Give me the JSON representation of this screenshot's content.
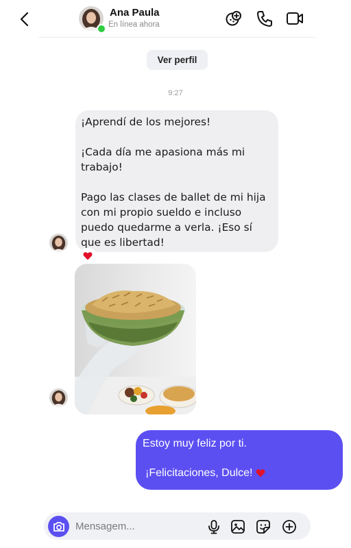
{
  "header": {
    "contact_name": "Ana Paula",
    "status": "En línea ahora",
    "icons": [
      "back-arrow-icon",
      "video-game-icon",
      "phone-icon",
      "video-camera-icon"
    ]
  },
  "profile_button": {
    "label": "Ver perfil"
  },
  "timestamp": "9:27",
  "incoming_message": {
    "paragraphs": [
      "¡Aprendí de los mejores!",
      "¡Cada día me apasiona más mi trabajo!",
      "Pago las clases de ballet de mi hija con mi propio sueldo e incluso puedo quedarme a verla. ¡Eso sí que es libertad!"
    ],
    "reaction": "heart-icon"
  },
  "outgoing_message": {
    "line1": "Estoy muy feliz por ti.",
    "line2": "¡Felicitaciones, Dulce!"
  },
  "composer": {
    "placeholder": "Mensagem...",
    "icons": [
      "camera-icon",
      "microphone-icon",
      "image-icon",
      "sticker-icon",
      "plus-icon"
    ]
  },
  "colors": {
    "accent": "#5b4ff2",
    "incoming_bubble": "#efeff2",
    "online": "#2ecc40",
    "heart": "#e0112b"
  }
}
